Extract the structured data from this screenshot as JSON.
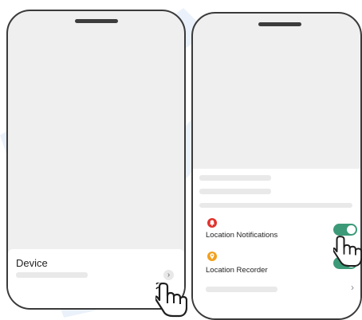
{
  "left_phone": {
    "device_label": "Device",
    "chevron_icon": "chevron-right",
    "chevron_glyph": "›"
  },
  "right_phone": {
    "settings": [
      {
        "label": "Location Notifications",
        "icon": "bell-icon",
        "icon_color": "#e0332e",
        "toggle_on": true
      },
      {
        "label": "Location Recorder",
        "icon": "location-pin-icon",
        "icon_color": "#f2a01c",
        "toggle_on": true
      }
    ],
    "chevron_glyph": "›"
  },
  "colors": {
    "toggle_on": "#3c9a78",
    "watermark": "#4f8fd9",
    "frame": "#3a3a3a"
  }
}
